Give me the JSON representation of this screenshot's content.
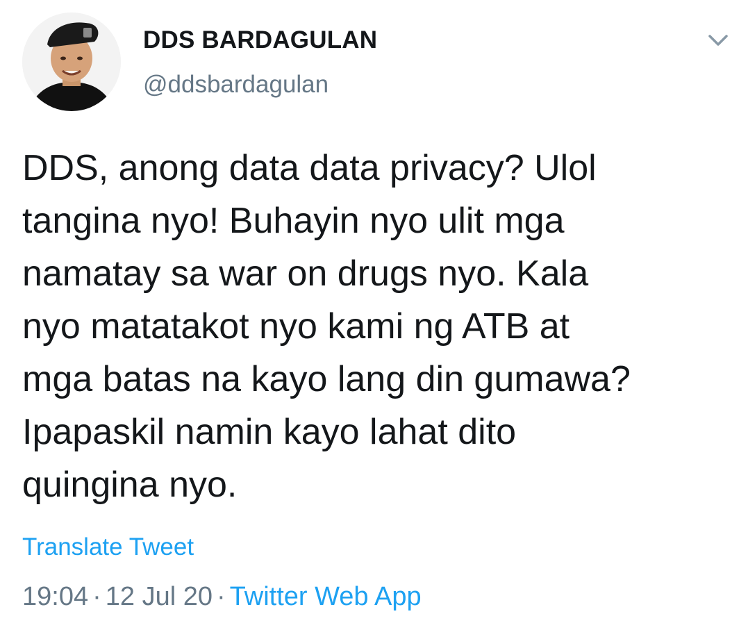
{
  "user": {
    "display_name": "DDS BARDAGULAN",
    "handle": "@ddsbardagulan",
    "avatar_icon": "profile-photo"
  },
  "tweet": {
    "text": "DDS, anong data data privacy? Ulol\ntangina nyo! Buhayin nyo ulit mga\nnamatay sa war on drugs nyo. Kala\nnyo matatakot nyo kami ng ATB at\nmga batas na kayo lang din gumawa?\nIpapaskil namin kayo lahat dito\nquingina nyo.",
    "translate_label": "Translate Tweet",
    "time": "19:04",
    "date": "12 Jul 20",
    "source": "Twitter Web App",
    "separator": "·"
  },
  "colors": {
    "text": "#14171a",
    "secondary": "#657786",
    "link": "#1da1f2",
    "background": "#ffffff"
  }
}
